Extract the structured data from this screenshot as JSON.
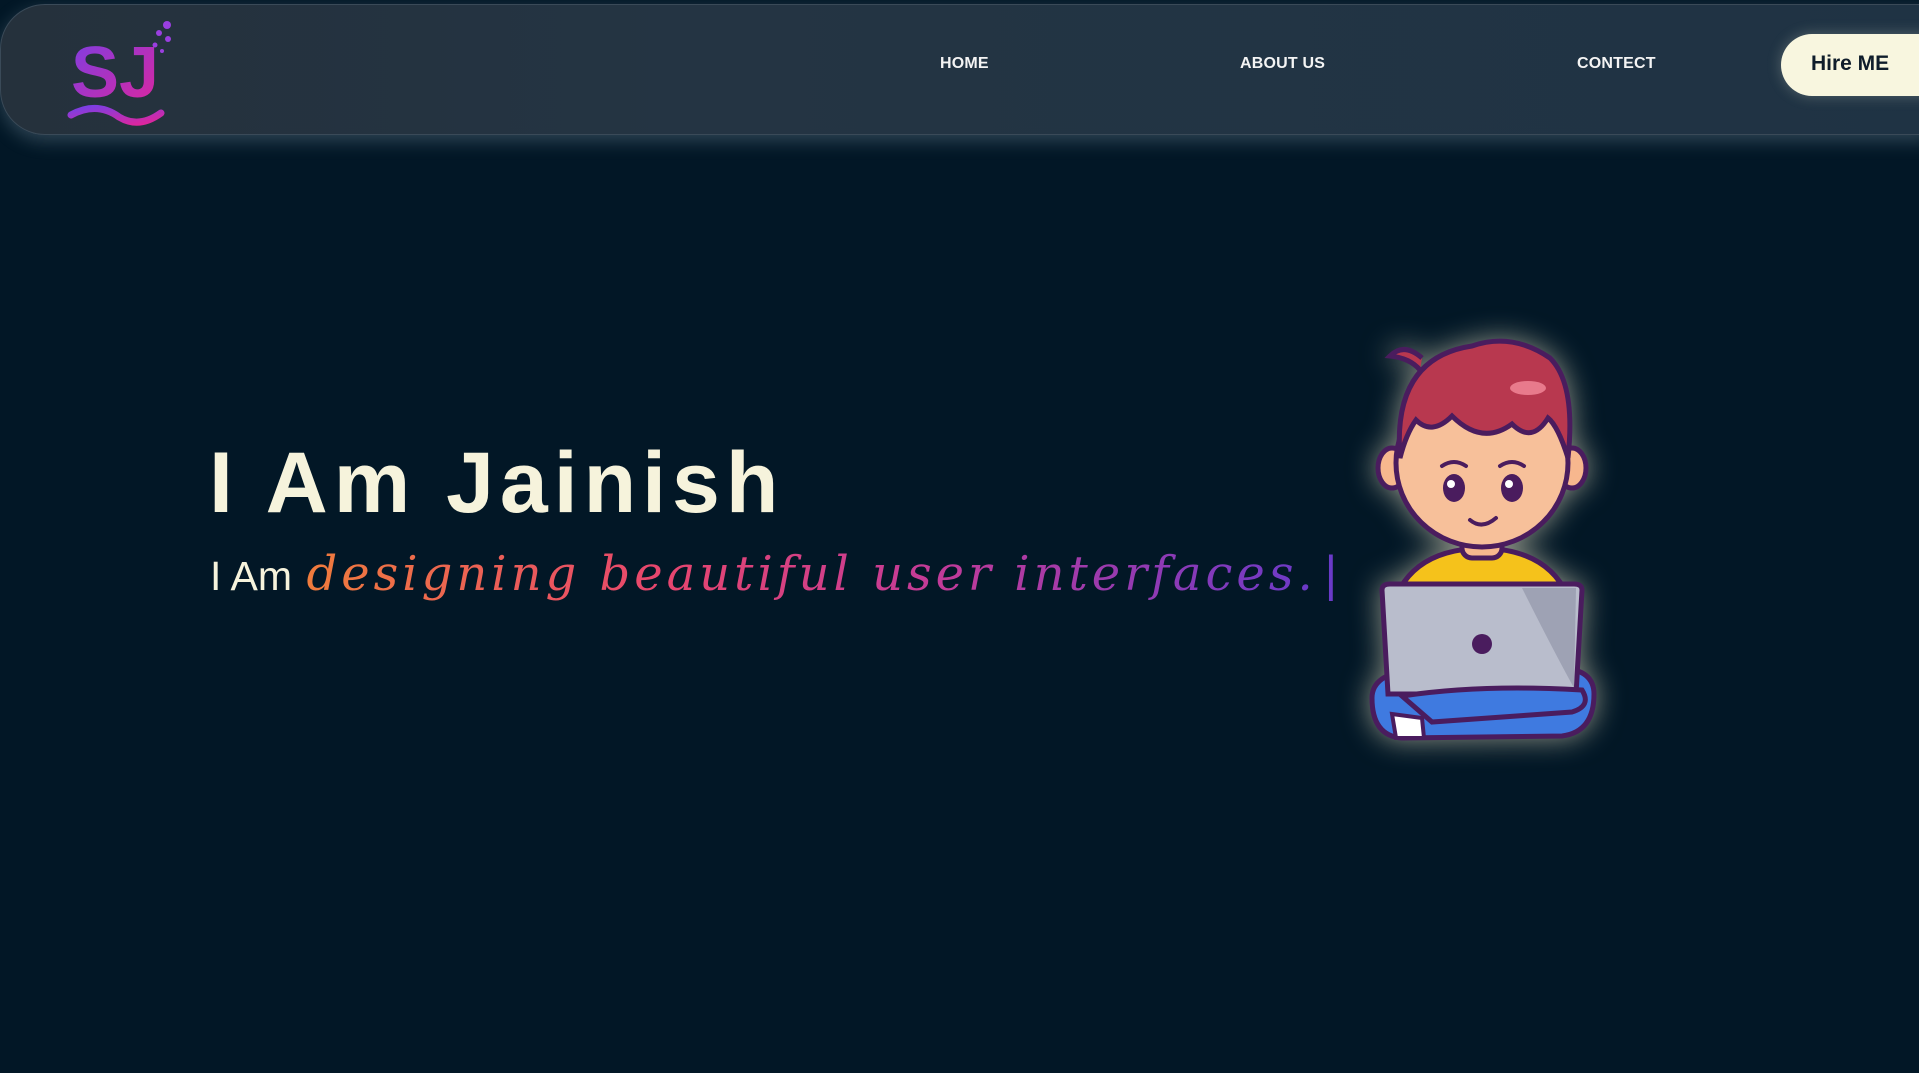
{
  "nav": {
    "logo_text": "SJ",
    "links": [
      "HOME",
      "ABOUT US",
      "CONTECT"
    ],
    "cta_label": "Hire ME"
  },
  "hero": {
    "title": "I Am Jainish",
    "subtitle_prefix": "I Am",
    "typed_text": "designing beautiful user interfaces.",
    "cursor": "|"
  },
  "colors": {
    "background": "#021726",
    "navbar": "#243443",
    "text_cream": "#f6f3dc",
    "cta_background": "#f8f6df",
    "gradient_orange": "#f07c3c",
    "gradient_pink": "#e7466e",
    "gradient_purple": "#6a3ac8"
  },
  "icons": {
    "logo": "sj-logo-icon",
    "avatar": "boy-with-laptop-illustration"
  }
}
